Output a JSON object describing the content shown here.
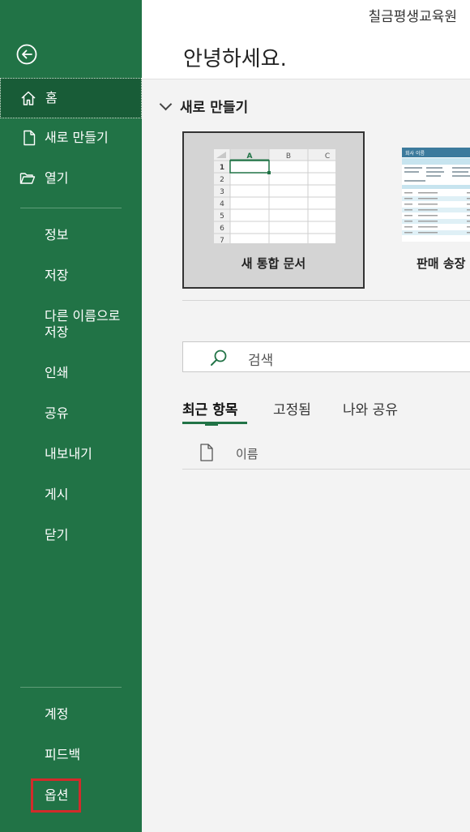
{
  "header": {
    "user_name": "칠금평생교육원",
    "greeting": "안녕하세요."
  },
  "sidebar": {
    "back_icon": "back-arrow-icon",
    "items": [
      {
        "label": "홈",
        "icon": "home-icon"
      },
      {
        "label": "새로 만들기",
        "icon": "new-file-icon"
      },
      {
        "label": "열기",
        "icon": "folder-open-icon"
      },
      {
        "label": "정보"
      },
      {
        "label": "저장"
      },
      {
        "label": "다른 이름으로\n저장"
      },
      {
        "label": "인쇄"
      },
      {
        "label": "공유"
      },
      {
        "label": "내보내기"
      },
      {
        "label": "게시"
      },
      {
        "label": "닫기"
      }
    ],
    "bottom": [
      {
        "label": "계정"
      },
      {
        "label": "피드백"
      },
      {
        "label": "옵션"
      }
    ]
  },
  "new_section": {
    "heading": "새로 만들기",
    "templates": [
      {
        "name": "새 통합 문서"
      },
      {
        "name": "판매 송장"
      }
    ],
    "sheet": {
      "columns": [
        "A",
        "B",
        "C"
      ],
      "rows": [
        "1",
        "2",
        "3",
        "4",
        "5",
        "6",
        "7"
      ]
    },
    "invoice_title": "회사 이름"
  },
  "search": {
    "placeholder": "검색"
  },
  "tabs": [
    {
      "label": "최근 항목"
    },
    {
      "label": "고정됨"
    },
    {
      "label": "나와 공유"
    }
  ],
  "recent_list": {
    "name_header": "이름"
  },
  "colors": {
    "sidebar": "#217346",
    "active": "#185c37",
    "highlight": "#d22b2b"
  }
}
